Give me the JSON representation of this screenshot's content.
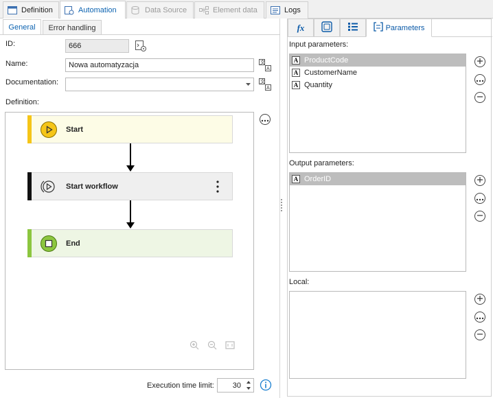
{
  "top_tabs": [
    {
      "label": "Definition",
      "icon": "definition-icon"
    },
    {
      "label": "Automation",
      "icon": "automation-icon"
    },
    {
      "label": "Data Source",
      "icon": "database-icon"
    },
    {
      "label": "Element data",
      "icon": "element-data-icon"
    },
    {
      "label": "Logs",
      "icon": "logs-icon"
    }
  ],
  "sub_tabs": [
    {
      "label": "General"
    },
    {
      "label": "Error handling"
    }
  ],
  "form": {
    "id_label": "ID:",
    "id_value": "666",
    "name_label": "Name:",
    "name_value": "Nowa automatyzacja",
    "doc_label": "Documentation:",
    "doc_value": "",
    "definition_label": "Definition:"
  },
  "flow": {
    "nodes": [
      {
        "label": "Start",
        "kind": "start",
        "color": "#f5c518",
        "fill": "#fdfce6"
      },
      {
        "label": "Start workflow",
        "kind": "action",
        "color": "#111111",
        "fill": "#efefef"
      },
      {
        "label": "End",
        "kind": "end",
        "color": "#8cc63f",
        "fill": "#eef6e4"
      }
    ]
  },
  "execution": {
    "label": "Execution time limit:",
    "value": "30"
  },
  "right_tabs": [
    {
      "label": "",
      "icon": "fx-icon"
    },
    {
      "label": "",
      "icon": "variable-icon"
    },
    {
      "label": "",
      "icon": "list-icon"
    },
    {
      "label": "Parameters",
      "icon": "parameters-icon"
    }
  ],
  "params": {
    "input_label": "Input parameters:",
    "input_items": [
      "ProductCode",
      "CustomerName",
      "Quantity"
    ],
    "output_label": "Output parameters:",
    "output_items": [
      "OrderID"
    ],
    "local_label": "Local:",
    "local_items": [],
    "type_glyph": "A"
  },
  "colors": {
    "accent": "#0b62b0",
    "selected_row": "#bdbdbd"
  }
}
